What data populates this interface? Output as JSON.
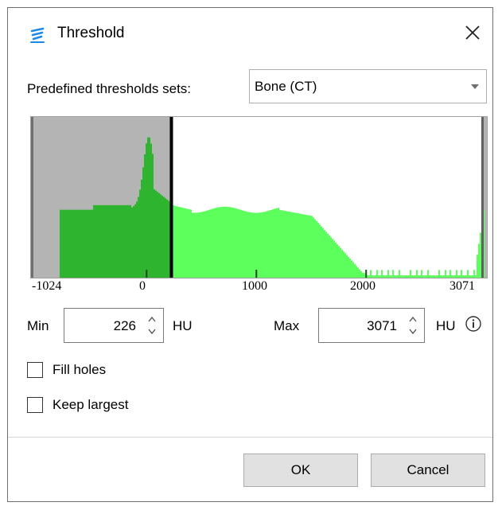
{
  "window": {
    "title": "Threshold"
  },
  "preset": {
    "label": "Predefined thresholds sets:",
    "selected": "Bone (CT)"
  },
  "histogram": {
    "x_min": -1024,
    "x_max": 3071,
    "tick_labels": [
      "-1024",
      "0",
      "1000",
      "2000",
      "3071"
    ],
    "selected_range": [
      226,
      3071
    ],
    "selected_color": "#5cff5c",
    "excluded_fill": "#b4b4b4",
    "excluded_bar_color": "#2fb42f",
    "marker_color": "#000000"
  },
  "min": {
    "label": "Min",
    "value": "226",
    "unit": "HU"
  },
  "max": {
    "label": "Max",
    "value": "3071",
    "unit": "HU"
  },
  "options": {
    "fill_holes": {
      "label": "Fill holes",
      "checked": false
    },
    "keep_largest": {
      "label": "Keep largest",
      "checked": false
    }
  },
  "buttons": {
    "ok": "OK",
    "cancel": "Cancel"
  }
}
